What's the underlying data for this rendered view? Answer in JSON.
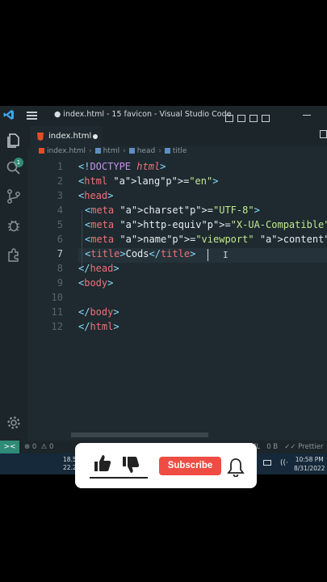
{
  "window": {
    "title": "● index.html - 15 favicon - Visual Studio Code"
  },
  "activity_bar": {
    "explorer_badge": "1"
  },
  "tabs": [
    {
      "label": "index.html",
      "dirty": true
    }
  ],
  "breadcrumb": [
    "index.html",
    "html",
    "head",
    "title"
  ],
  "editor": {
    "line_numbers": [
      "1",
      "2",
      "3",
      "4",
      "5",
      "6",
      "7",
      "8",
      "9",
      "10",
      "11",
      "12"
    ],
    "current_line": "7",
    "lines": [
      "<!DOCTYPE html>",
      "<html lang=\"en\">",
      "<head>",
      "<meta charset=\"UTF-8\">",
      "<meta http-equiv=\"X-UA-Compatible\" con",
      "<meta name=\"viewport\" content=\"width=d",
      "<title>Cods</title>",
      "</head>",
      "<body>",
      "",
      "</body>",
      "</html>"
    ]
  },
  "status_bar": {
    "remote": "><",
    "errors": "0",
    "warnings": "0",
    "language": "ML",
    "size": "0 B",
    "formatter": "Prettier"
  },
  "taskbar": {
    "weather_a": "18.5",
    "weather_b": "22.2",
    "time": "10:58 PM",
    "date": "8/31/2022"
  },
  "overlay": {
    "subscribe_label": "Subscribe"
  },
  "colors": {
    "accent": "#2e8b77",
    "subscribe": "#ef4c43",
    "editor_bg": "#1e2a30"
  }
}
